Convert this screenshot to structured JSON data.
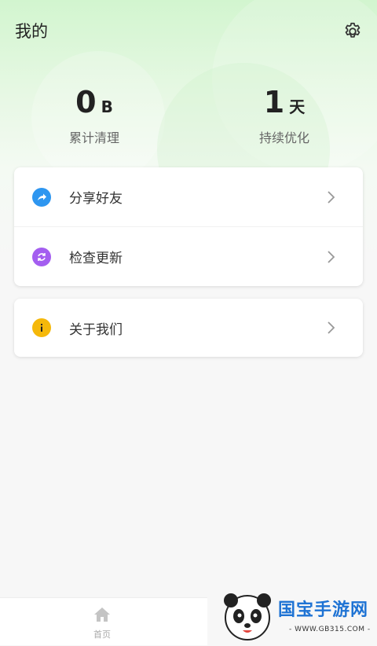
{
  "header": {
    "title": "我的"
  },
  "stats": {
    "cleaned": {
      "value": "0",
      "unit": "B",
      "label": "累计清理"
    },
    "optimized": {
      "value": "1",
      "unit": "天",
      "label": "持续优化"
    }
  },
  "menu": {
    "group1": [
      {
        "label": "分享好友",
        "icon": "share-icon",
        "color": "#2e96f0"
      },
      {
        "label": "检查更新",
        "icon": "refresh-icon",
        "color": "#a45ef0"
      }
    ],
    "group2": [
      {
        "label": "关于我们",
        "icon": "info-icon",
        "color": "#f5b80a"
      }
    ]
  },
  "bottom_nav": {
    "home_label": "首页"
  },
  "watermark": {
    "brand": "国宝手游网",
    "url": "- WWW.GB315.COM -"
  }
}
